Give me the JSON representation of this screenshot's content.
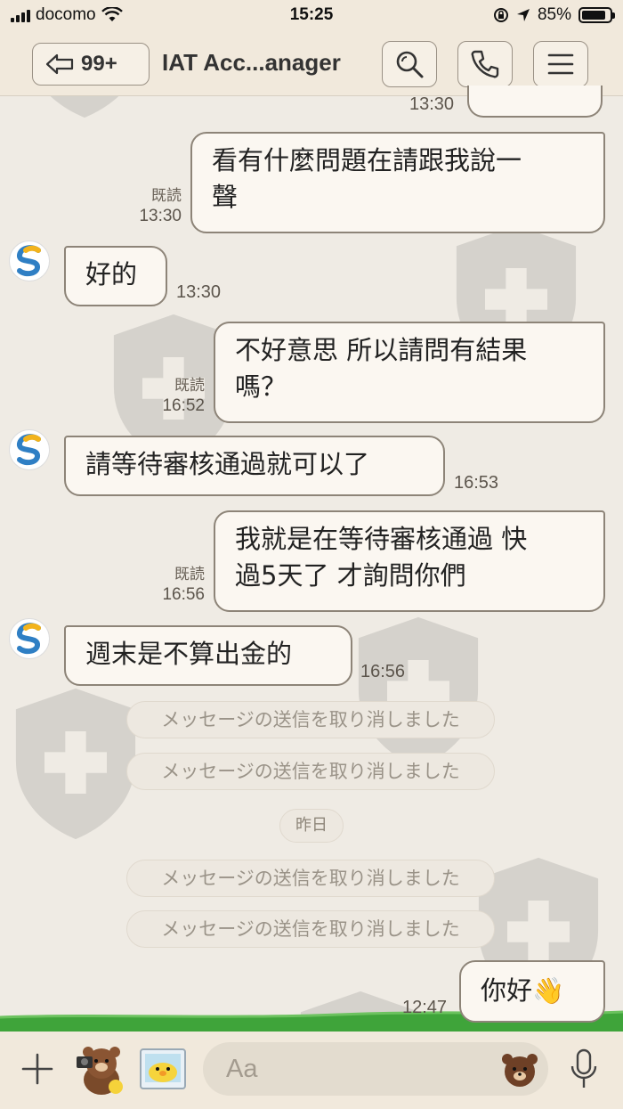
{
  "status": {
    "carrier": "docomo",
    "time": "15:25",
    "battery": "85%",
    "battery_level": 0.85
  },
  "nav": {
    "back_count": "99+",
    "title": "IAT Acc...anager"
  },
  "messages": {
    "partial_time": "13:30",
    "m1": {
      "text": "看有什麼問題在請跟我說一聲",
      "line1": "看有什麼問題在請跟我說一",
      "line2": "聲",
      "read": "既読",
      "time": "13:30"
    },
    "m2": {
      "text": "好的",
      "time": "13:30"
    },
    "m3": {
      "line1": "不好意思 所以請問有結果",
      "line2": "嗎？",
      "read": "既読",
      "time": "16:52"
    },
    "m4": {
      "text": "請等待審核通過就可以了",
      "time": "16:53"
    },
    "m5": {
      "line1": "我就是在等待審核通過 快",
      "line2": "過5天了 才詢問你們",
      "read": "既読",
      "time": "16:56"
    },
    "m6": {
      "text": "週末是不算出金的",
      "time": "16:56"
    },
    "system1": "メッセージの送信を取り消しました",
    "system2": "メッセージの送信を取り消しました",
    "date_divider": "昨日",
    "system3": "メッセージの送信を取り消しました",
    "system4": "メッセージの送信を取り消しました",
    "m7": {
      "text": "你好👋",
      "time": "12:47"
    }
  },
  "input": {
    "placeholder": "Aa"
  },
  "colors": {
    "background": "#efebe4",
    "bar": "#f1e9dc",
    "bubble": "#fbf7f1",
    "bubble_border": "#8d8478",
    "grass": "#3fa43a"
  }
}
